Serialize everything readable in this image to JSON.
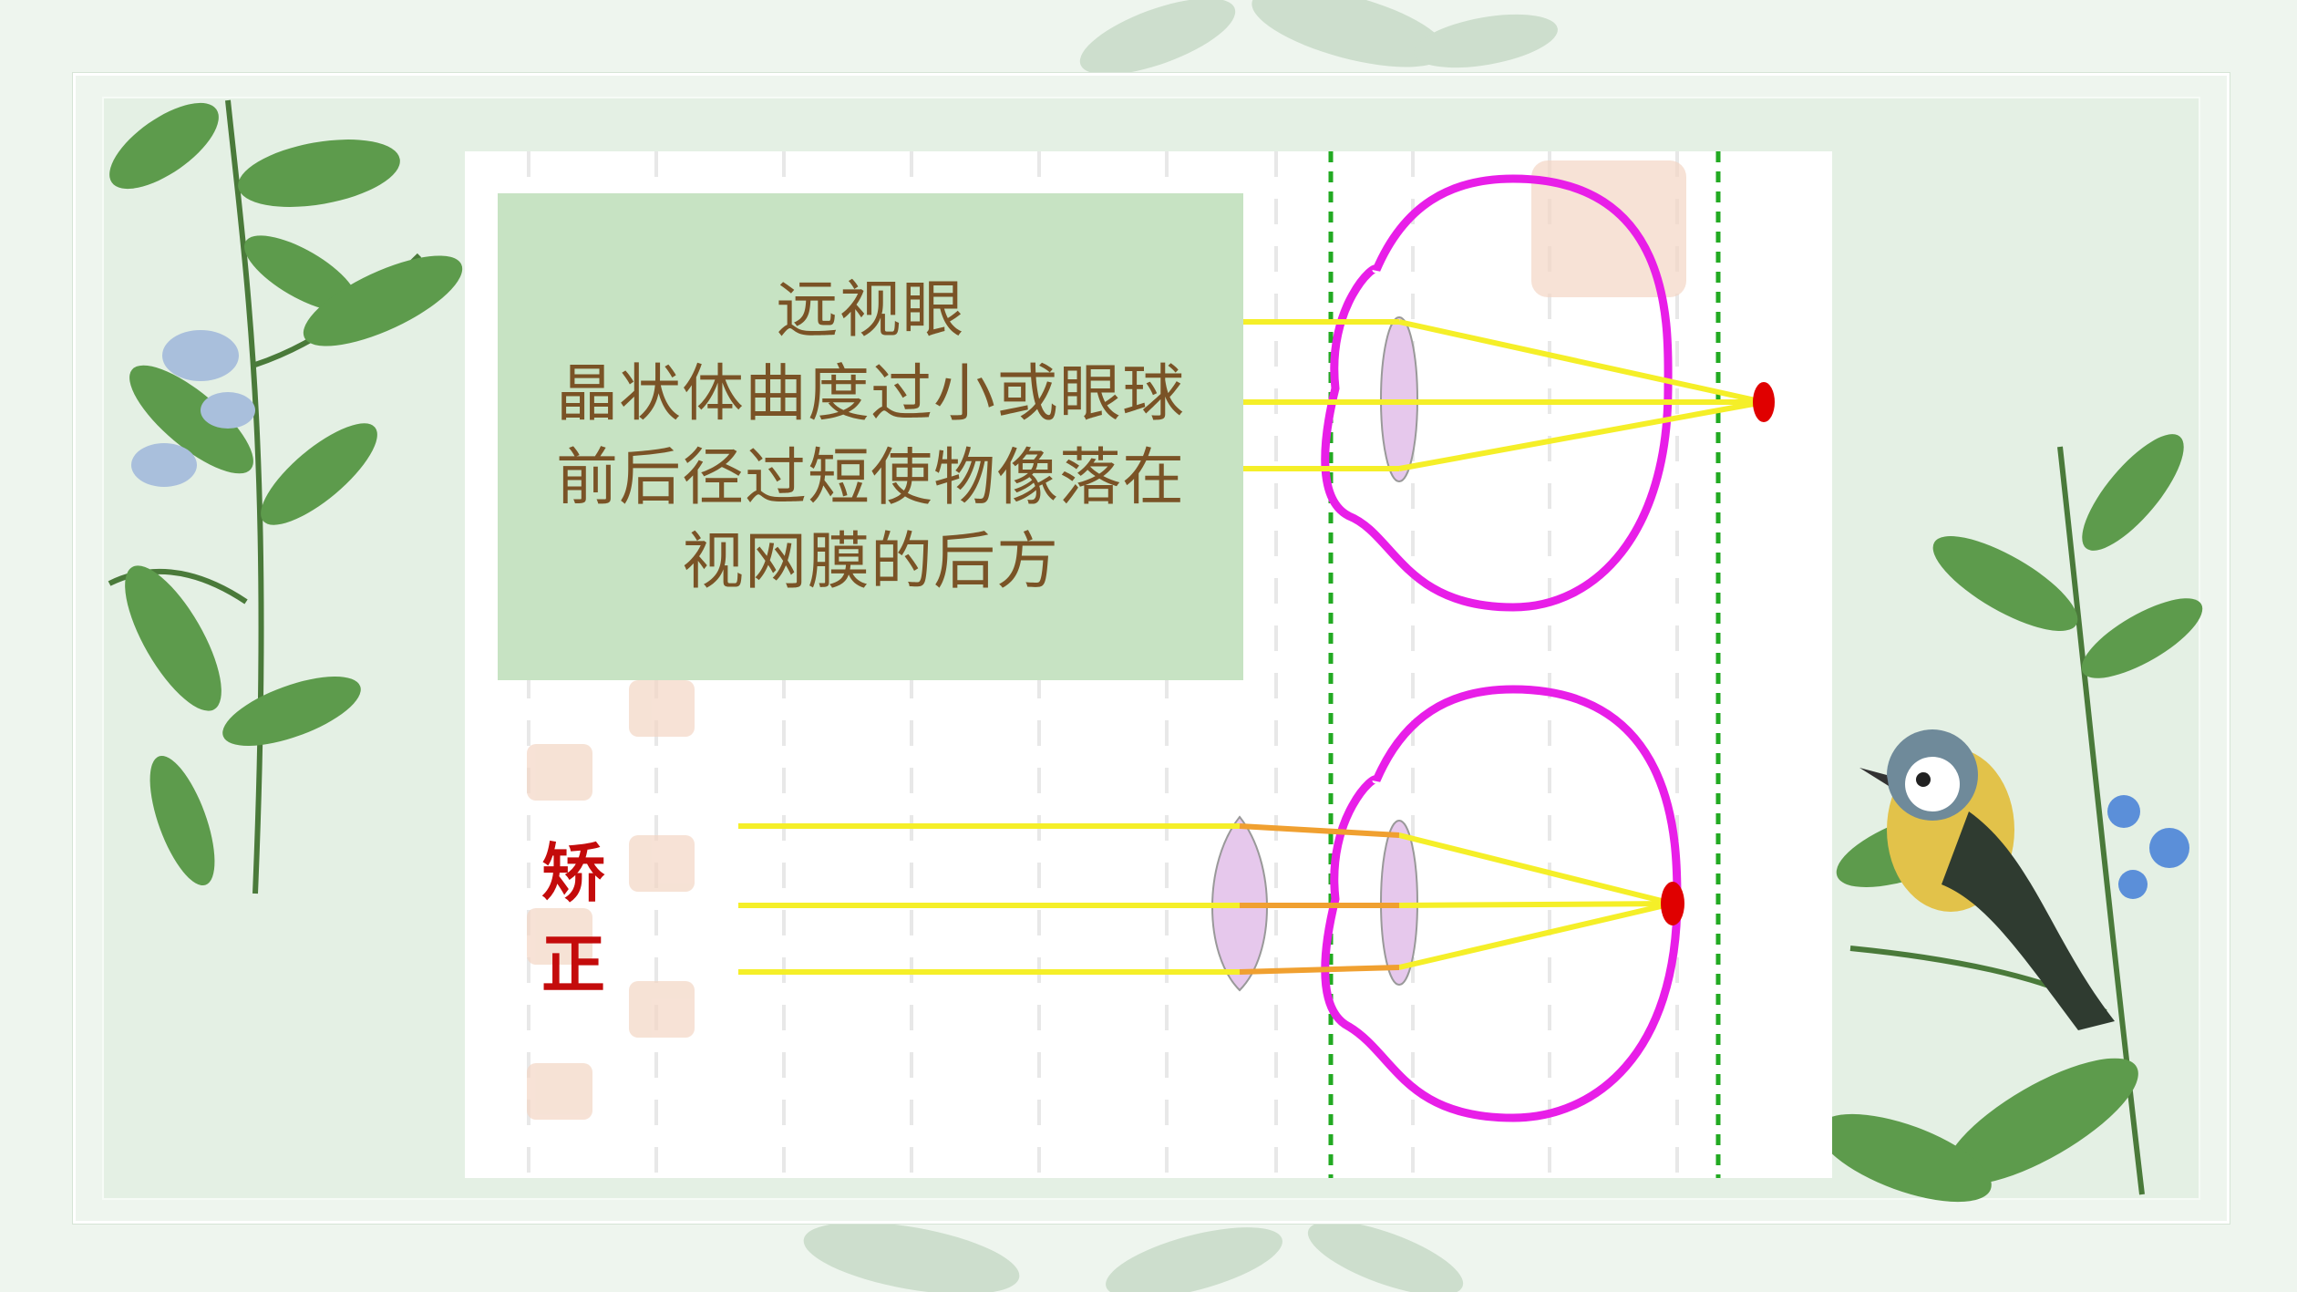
{
  "info_box": {
    "lines": [
      "远视眼",
      "晶状体曲度过小或眼球",
      "前后径过短使物像落在",
      "视网膜的后方"
    ]
  },
  "correction": {
    "char_1": "矫",
    "char_2": "正"
  },
  "colors": {
    "eyeball": "#e81ee8",
    "light_ray": "#f5ef28",
    "corrected_ray": "#f0a030",
    "focus_point": "#e00000",
    "retina_guide": "#22aa22",
    "lens_fill": "#e6c8ec",
    "info_box_bg": "#c7e3c3",
    "info_text": "#7a5326"
  }
}
